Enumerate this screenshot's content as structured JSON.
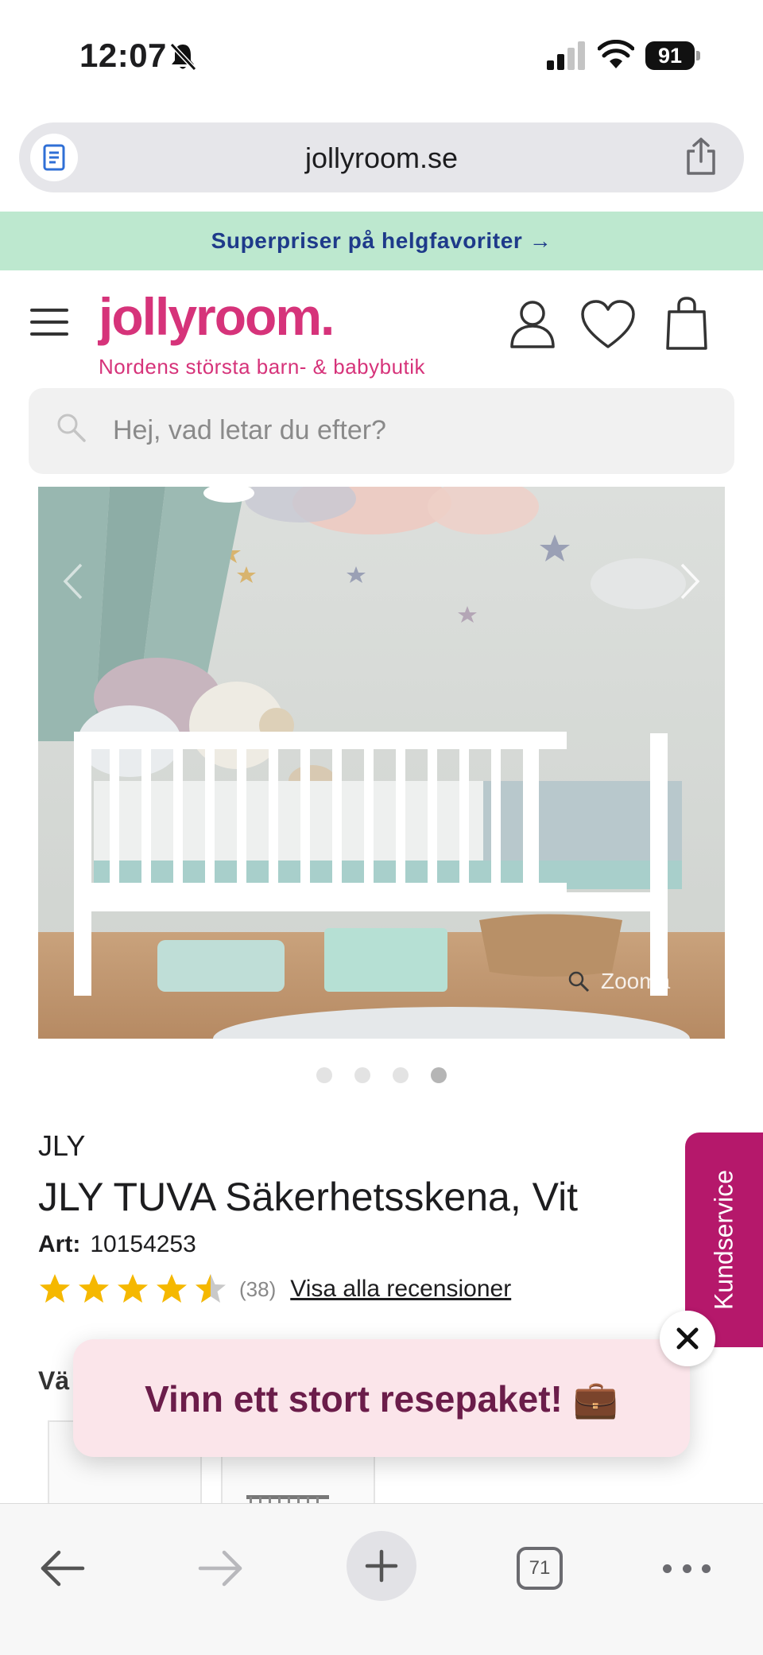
{
  "status_bar": {
    "time": "12:07",
    "battery": "91"
  },
  "browser": {
    "url": "jollyroom.se",
    "tab_count": "71"
  },
  "promo_banner": {
    "text": "Superpriser på helgfavoriter →"
  },
  "header": {
    "logo": "jollyroom.",
    "tagline": "Nordens största barn- & babybutik"
  },
  "search": {
    "placeholder": "Hej, vad letar du efter?"
  },
  "gallery": {
    "zoom_label": "Zooma",
    "total_images": 4,
    "active_index": 4
  },
  "product": {
    "brand": "JLY",
    "title": "JLY TUVA Säkerhetsskena, Vit",
    "art_label": "Art:",
    "art_number": "10154253",
    "rating": 4.5,
    "review_count": "(38)",
    "reviews_link": "Visa alla recensioner",
    "partial_section_label": "Vä"
  },
  "kundservice": {
    "label": "Kundservice"
  },
  "popup": {
    "text": "Vinn ett stort resepaket! 💼"
  },
  "colors": {
    "brand_pink": "#d6337a",
    "banner_green": "#bde8cf",
    "kundservice_bg": "#b5186b",
    "popup_bg": "#fbe5ea",
    "star": "#f5b800"
  }
}
